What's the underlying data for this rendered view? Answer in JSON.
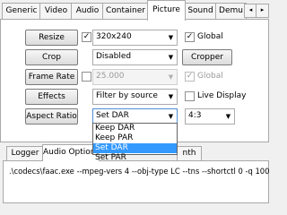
{
  "top_tabs": [
    {
      "label": "Generic",
      "active": false
    },
    {
      "label": "Video",
      "active": false
    },
    {
      "label": "Audio",
      "active": false
    },
    {
      "label": "Container",
      "active": false
    },
    {
      "label": "Picture",
      "active": true
    },
    {
      "label": "Sound",
      "active": false
    },
    {
      "label": "Demu",
      "active": false
    }
  ],
  "tab_scroll": {
    "left": "◂",
    "right": "▸"
  },
  "rows": {
    "resize": {
      "button": "Resize",
      "checked_mark": "✓",
      "value": "320x240",
      "global_label": "Global",
      "global_checked": "✓"
    },
    "crop": {
      "button": "Crop",
      "value": "Disabled",
      "cropper_button": "Cropper"
    },
    "frame_rate": {
      "button": "Frame Rate",
      "value": "25.000",
      "global_label": "Global",
      "global_checked": "✓"
    },
    "effects": {
      "button": "Effects",
      "value": "Filter by source",
      "live_display_label": "Live Display"
    },
    "aspect_ratio": {
      "button": "Aspect Ratio",
      "value": "Set DAR",
      "ratio_value": "4:3"
    }
  },
  "dropdown_options": [
    {
      "label": "Keep DAR",
      "selected": false
    },
    {
      "label": "Keep PAR",
      "selected": false
    },
    {
      "label": "Set DAR",
      "selected": true
    },
    {
      "label": "Set PAR",
      "selected": false
    }
  ],
  "bottom_tabs": [
    {
      "label": "Logger",
      "active": false
    },
    {
      "label": "Audio Options",
      "active": true
    },
    {
      "label": "nth",
      "active": false
    }
  ],
  "log_text": ".\\codecs\\faac.exe --mpeg-vers 4 --obj-type LC --tns --shortctl 0 -q 100"
}
